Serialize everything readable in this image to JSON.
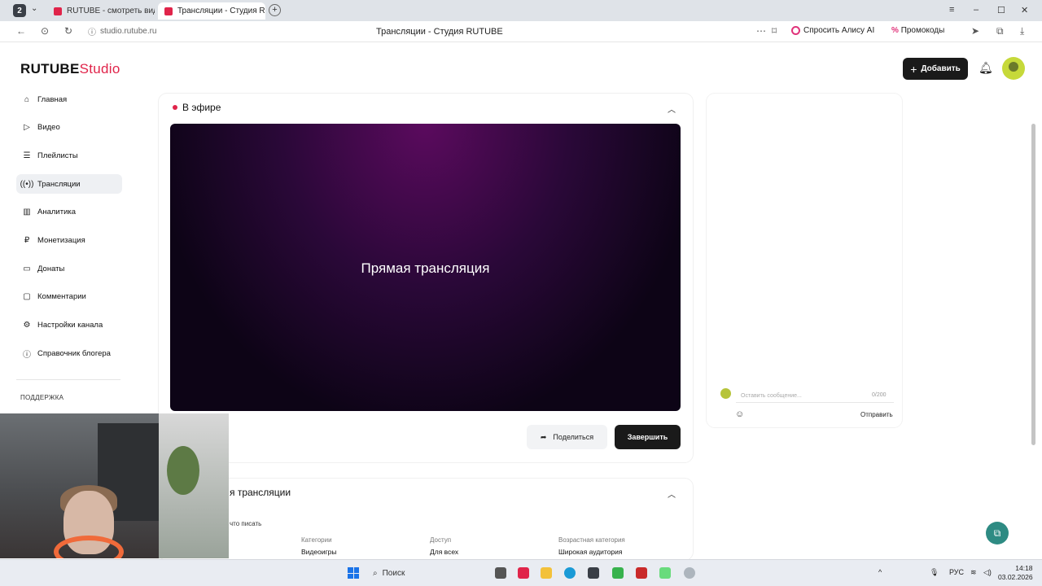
{
  "browser": {
    "tab_count": "2",
    "tabs": [
      {
        "label": "RUTUBE - смотреть виде"
      },
      {
        "label": "Трансляции - Студия R"
      }
    ],
    "url": "studio.rutube.ru",
    "page_title": "Трансляции - Студия RUTUBE",
    "alice_label": "Спросить Алису AI",
    "promo_label": "Промокоды"
  },
  "header": {
    "logo_main": "RUTUBE",
    "logo_sub": "Studio",
    "add_button": "Добавить"
  },
  "sidebar": {
    "items": [
      {
        "label": "Главная",
        "icon": "home-icon"
      },
      {
        "label": "Видео",
        "icon": "video-icon"
      },
      {
        "label": "Плейлисты",
        "icon": "playlist-icon"
      },
      {
        "label": "Трансляции",
        "icon": "broadcast-icon",
        "active": true
      },
      {
        "label": "Аналитика",
        "icon": "analytics-icon"
      },
      {
        "label": "Монетизация",
        "icon": "money-icon"
      },
      {
        "label": "Донаты",
        "icon": "donate-icon"
      },
      {
        "label": "Комментарии",
        "icon": "comment-icon"
      },
      {
        "label": "Настройки канала",
        "icon": "gear-icon"
      },
      {
        "label": "Справочник блогера",
        "icon": "info-icon"
      }
    ],
    "support": "ПОДДЕРЖКА"
  },
  "live": {
    "status": "В эфире",
    "player_text": "Прямая трансляция",
    "share_label": "Поделиться",
    "end_label": "Завершить"
  },
  "chat": {
    "placeholder": "Оставить сообщение...",
    "counter": "0/200",
    "send_label": "Отправить"
  },
  "info": {
    "title": "я трансляции",
    "hint": "что писать",
    "columns": [
      {
        "label": "Категории",
        "value": "Видеоигры"
      },
      {
        "label": "Доступ",
        "value": "Для всех"
      },
      {
        "label": "Возрастная категория",
        "value": "Широкая аудитория"
      }
    ]
  },
  "taskbar": {
    "search_label": "Поиск",
    "lang": "РУС",
    "time": "14:18",
    "date": "03.02.2026"
  },
  "colors": {
    "accent": "#e0244a",
    "dark_button": "#1a1a1a",
    "fab": "#2e8b83"
  }
}
